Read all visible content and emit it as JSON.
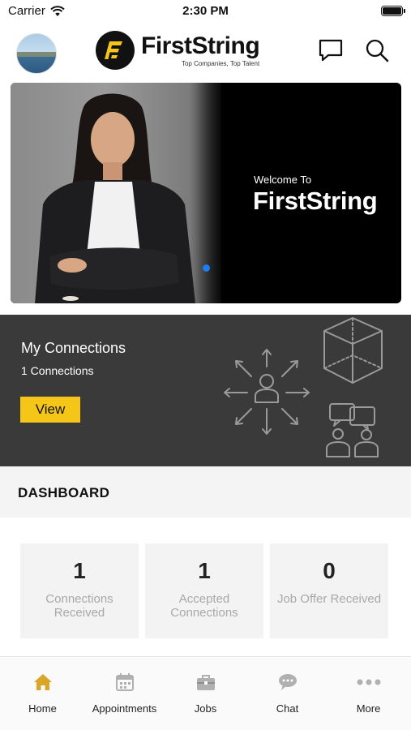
{
  "status_bar": {
    "carrier": "Carrier",
    "time": "2:30 PM"
  },
  "header": {
    "logo_name": "FirstString",
    "logo_tagline": "Top Companies, Top Talent"
  },
  "banner": {
    "welcome": "Welcome To",
    "title": "FirstString",
    "active_slide": 1
  },
  "connections": {
    "title": "My Connections",
    "count_text": "1 Connections",
    "view_label": "View"
  },
  "dashboard": {
    "title": "DASHBOARD",
    "stats": [
      {
        "value": "1",
        "label": "Connections Received"
      },
      {
        "value": "1",
        "label": "Accepted Connections"
      },
      {
        "value": "0",
        "label": "Job Offer Received"
      }
    ]
  },
  "tab_bar": {
    "items": [
      {
        "label": "Home",
        "icon": "home-icon",
        "active": true
      },
      {
        "label": "Appointments",
        "icon": "calendar-icon",
        "active": false
      },
      {
        "label": "Jobs",
        "icon": "briefcase-icon",
        "active": false
      },
      {
        "label": "Chat",
        "icon": "chat-bubble-icon",
        "active": false
      },
      {
        "label": "More",
        "icon": "more-dots-icon",
        "active": false
      }
    ]
  },
  "colors": {
    "accent": "#f5c518",
    "active_tab": "#d9a62a",
    "inactive_tab": "#b0b0b0",
    "dark_panel": "#3a3a3a",
    "slide_dot": "#1e7bf2"
  }
}
